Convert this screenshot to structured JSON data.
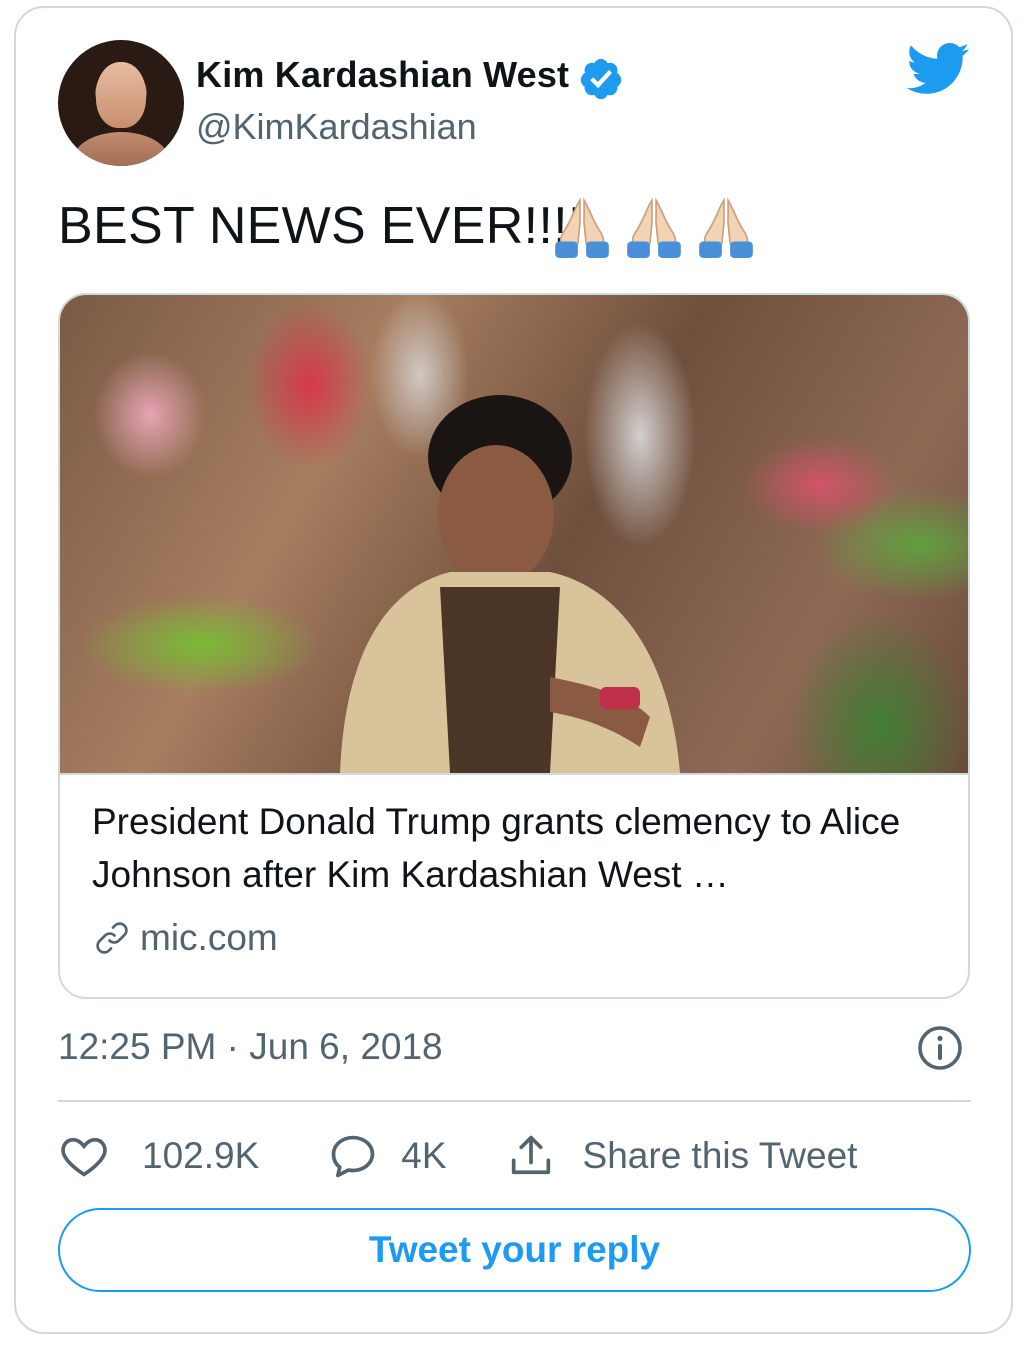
{
  "author": {
    "display_name": "Kim Kardashian West",
    "handle": "@KimKardashian",
    "verified": true,
    "avatar_icon": "profile-photo"
  },
  "tweet": {
    "text": "BEST NEWS EVER!!!!",
    "emoji": [
      "folded-hands",
      "folded-hands",
      "folded-hands"
    ]
  },
  "link_card": {
    "title": "President Donald Trump grants clemency to Alice Johnson after Kim Kardashian West …",
    "domain": "mic.com",
    "link_icon": "link-icon"
  },
  "meta": {
    "timestamp": "12:25 PM · Jun 6, 2018"
  },
  "actions": {
    "likes": "102.9K",
    "replies": "4K",
    "share_label": "Share this Tweet"
  },
  "reply_button": {
    "label": "Tweet your reply"
  },
  "colors": {
    "brand": "#1d9bf0",
    "text": "#0f1419",
    "secondary": "#536471",
    "border": "#cfd9de"
  }
}
